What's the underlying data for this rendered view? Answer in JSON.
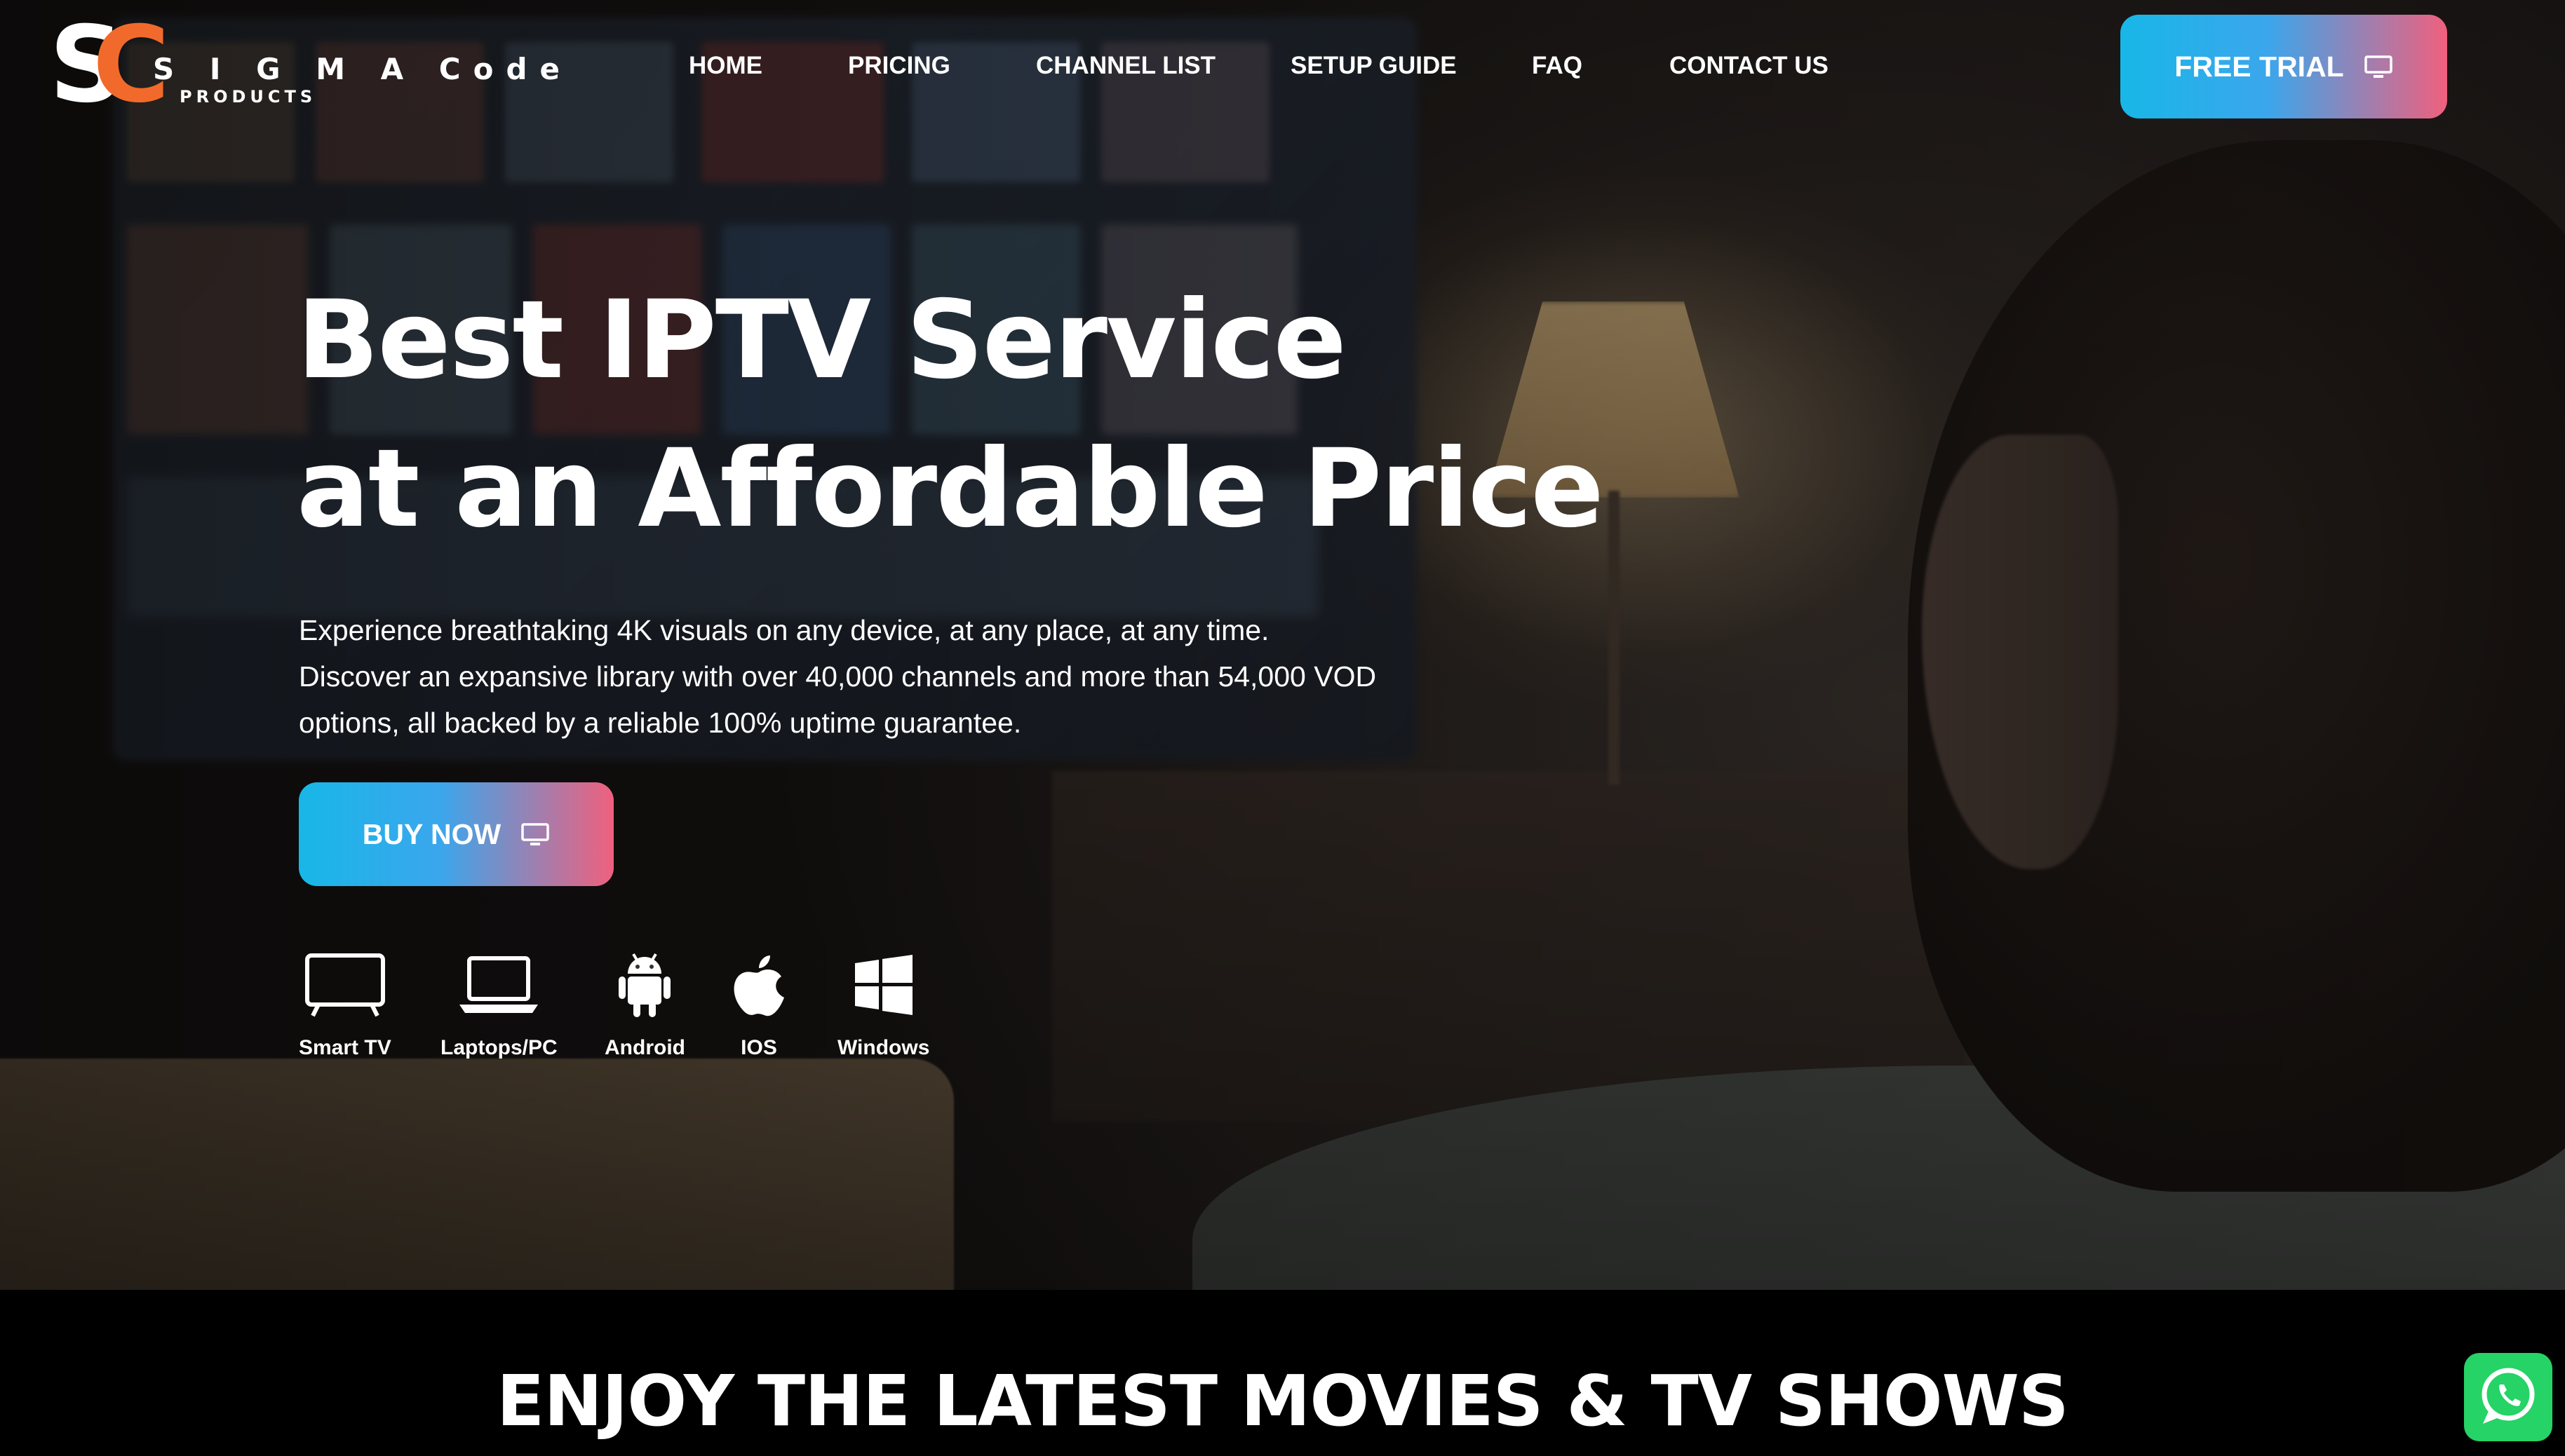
{
  "header": {
    "logo_text": "S I G M A Code",
    "logo_subtext": "PRODUCTS",
    "logo_letters": [
      "S",
      "C"
    ],
    "nav": [
      {
        "label": "HOME"
      },
      {
        "label": "PRICING"
      },
      {
        "label": "CHANNEL LIST"
      },
      {
        "label": "SETUP GUIDE"
      },
      {
        "label": "FAQ"
      },
      {
        "label": "CONTACT US"
      }
    ],
    "trial_button": {
      "label": "FREE TRIAL",
      "icon": "monitor-icon"
    }
  },
  "hero": {
    "headline_line1": "Best IPTV Service",
    "headline_line2": "at an Affordable Price",
    "subtext_line1": "Experience breathtaking 4K visuals on any device, at any place, at any time.",
    "subtext_line2": "Discover an expansive library with over 40,000 channels and more than 54,000 VOD",
    "subtext_line3": "options, all backed by a reliable 100% uptime guarantee.",
    "buy_button": {
      "label": "BUY NOW",
      "icon": "monitor-icon"
    },
    "platforms": [
      {
        "label": "Smart TV",
        "icon": "smart-tv-icon"
      },
      {
        "label": "Laptops/PC",
        "icon": "laptop-icon"
      },
      {
        "label": "Android",
        "icon": "android-icon"
      },
      {
        "label": "IOS",
        "icon": "apple-icon"
      },
      {
        "label": "Windows",
        "icon": "windows-icon"
      }
    ]
  },
  "section": {
    "title": "ENJOY THE LATEST MOVIES & TV SHOWS"
  },
  "floating": {
    "whatsapp_icon": "whatsapp-icon"
  },
  "colors": {
    "accent_start": "#18b7e8",
    "accent_end": "#f0607e",
    "logo_orange": "#f26a2b",
    "whatsapp_green": "#25d366"
  }
}
